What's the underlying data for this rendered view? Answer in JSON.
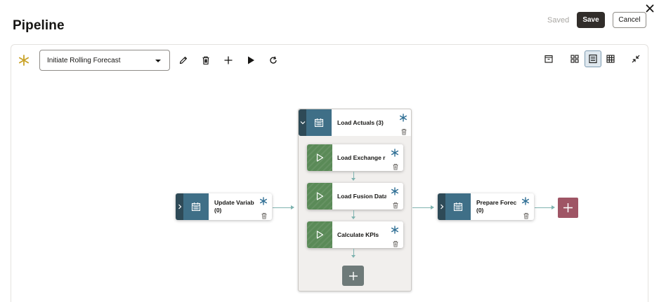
{
  "header": {
    "title": "Pipeline",
    "saved_status": "Saved",
    "save_label": "Save",
    "cancel_label": "Cancel"
  },
  "toolbar": {
    "selected_pipeline": "Initiate Rolling Forecast",
    "left_icons": [
      "edit-icon",
      "delete-icon",
      "add-icon",
      "run-icon",
      "refresh-icon"
    ],
    "right_icons": [
      "archive-icon",
      "grid-view-icon",
      "list-view-icon",
      "table-view-icon",
      "collapse-icon"
    ],
    "active_view": "list-view-icon"
  },
  "stages": [
    {
      "label": "Update Variab",
      "count": "(0)",
      "type": "stage"
    },
    {
      "label": "Load Actuals (3)",
      "type": "group",
      "jobs": [
        {
          "label": "Load Exchange r"
        },
        {
          "label": "Load Fusion Data"
        },
        {
          "label": "Calculate KPIs"
        }
      ]
    },
    {
      "label": "Prepare Forec",
      "count": "(0)",
      "type": "stage"
    }
  ],
  "colors": {
    "accent_gold": "#c9a227",
    "stage_blue": "#3f6f87",
    "stage_dark": "#2e4a57",
    "job_green": "#5a8a57",
    "asterisk_blue": "#2f6f95",
    "connector": "#7fb3b0",
    "add_gray": "#6e7a79",
    "add_rose": "#9f5565",
    "save_bg": "#312d2a"
  }
}
